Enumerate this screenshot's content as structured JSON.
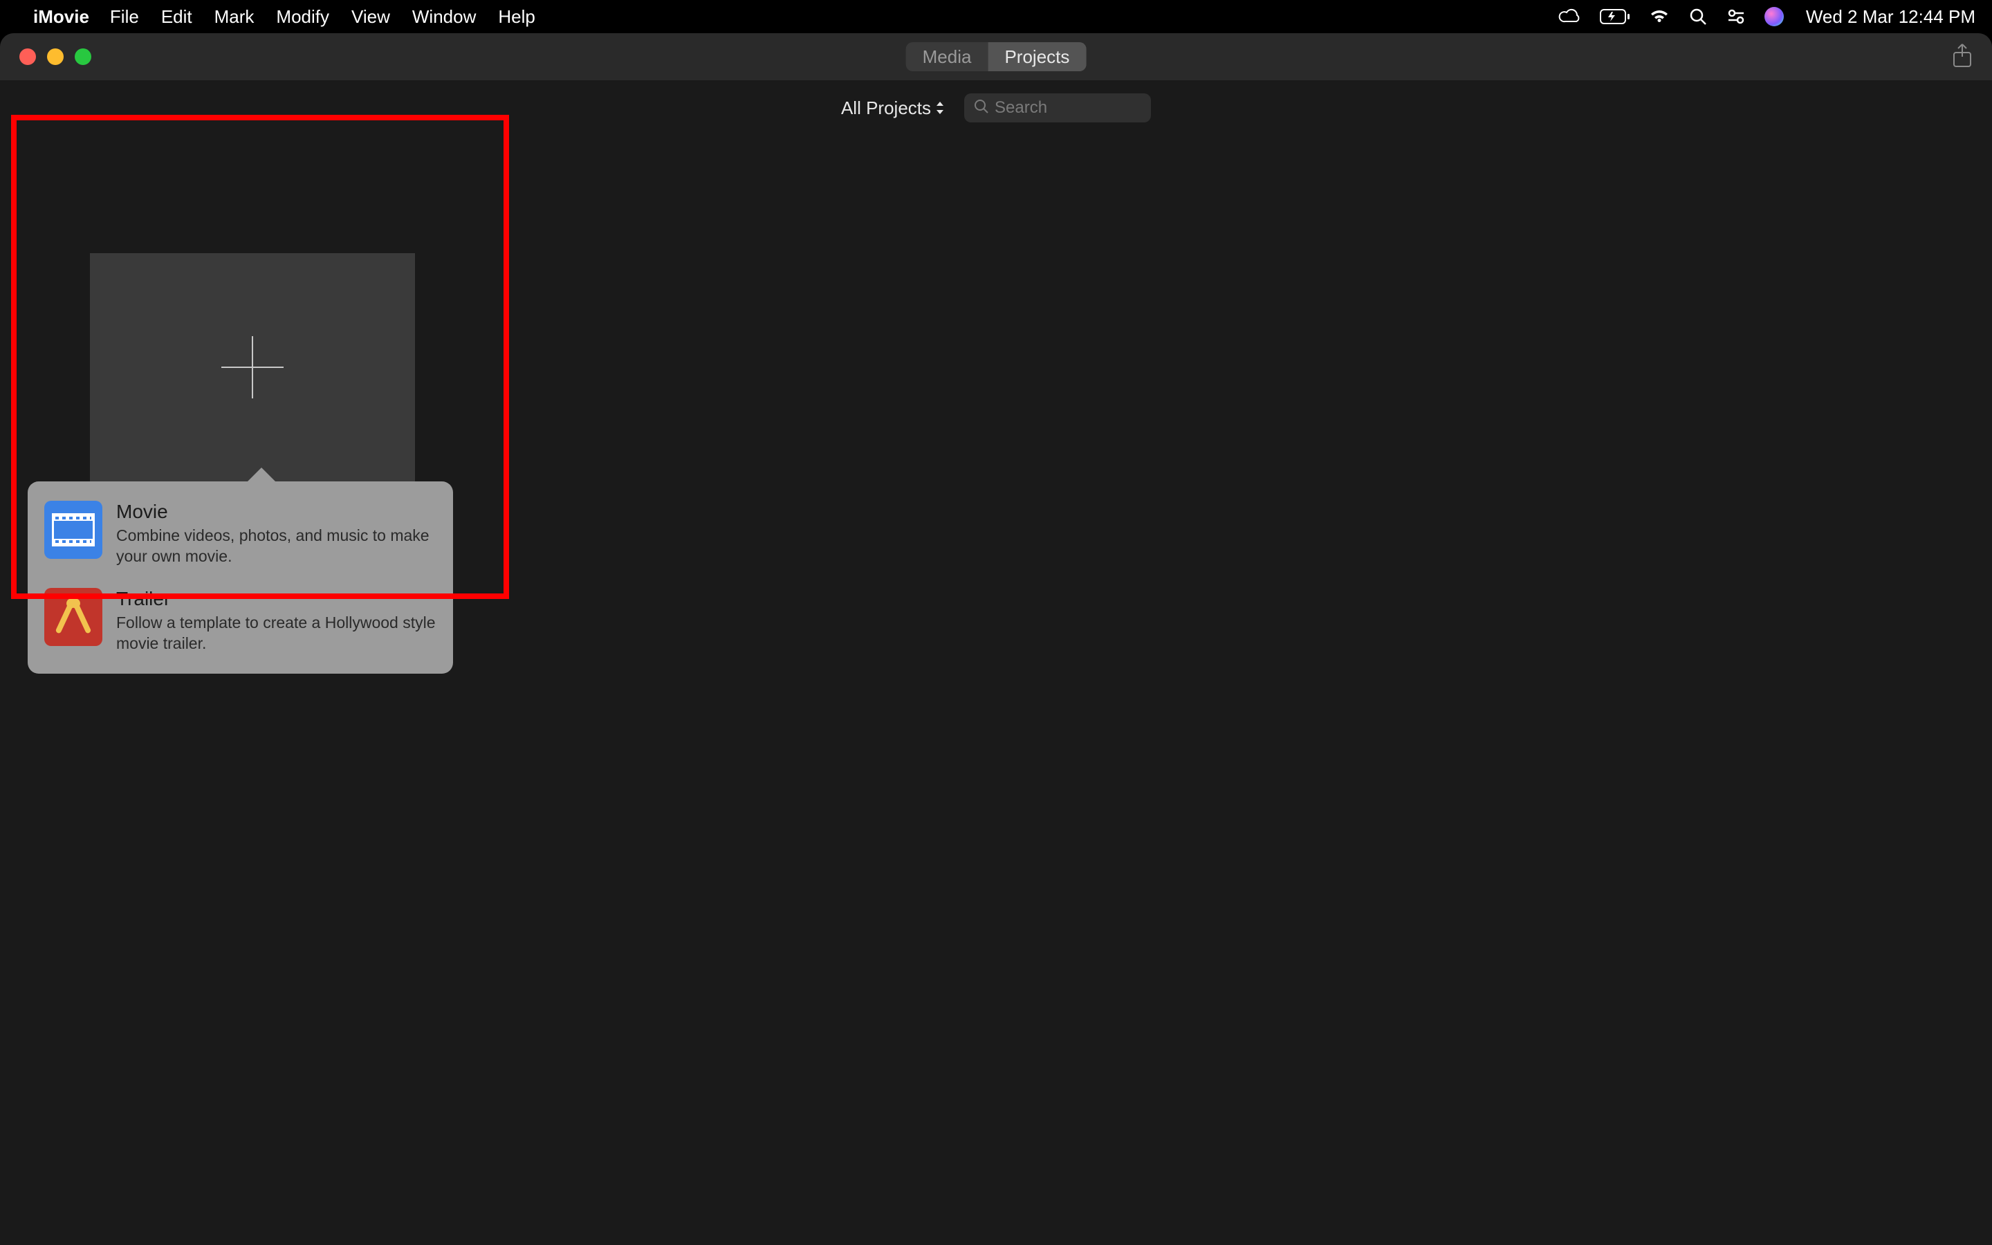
{
  "menubar": {
    "app": "iMovie",
    "items": [
      "File",
      "Edit",
      "Mark",
      "Modify",
      "View",
      "Window",
      "Help"
    ],
    "datetime": "Wed 2 Mar  12:44 PM"
  },
  "titlebar": {
    "tabs": {
      "media": "Media",
      "projects": "Projects"
    },
    "active_tab": "projects"
  },
  "subtoolbar": {
    "filter_label": "All Projects",
    "search_placeholder": "Search"
  },
  "popover": {
    "movie": {
      "title": "Movie",
      "desc": "Combine videos, photos, and music to make your own movie."
    },
    "trailer": {
      "title": "Trailer",
      "desc": "Follow a template to create a Hollywood style movie trailer."
    }
  }
}
